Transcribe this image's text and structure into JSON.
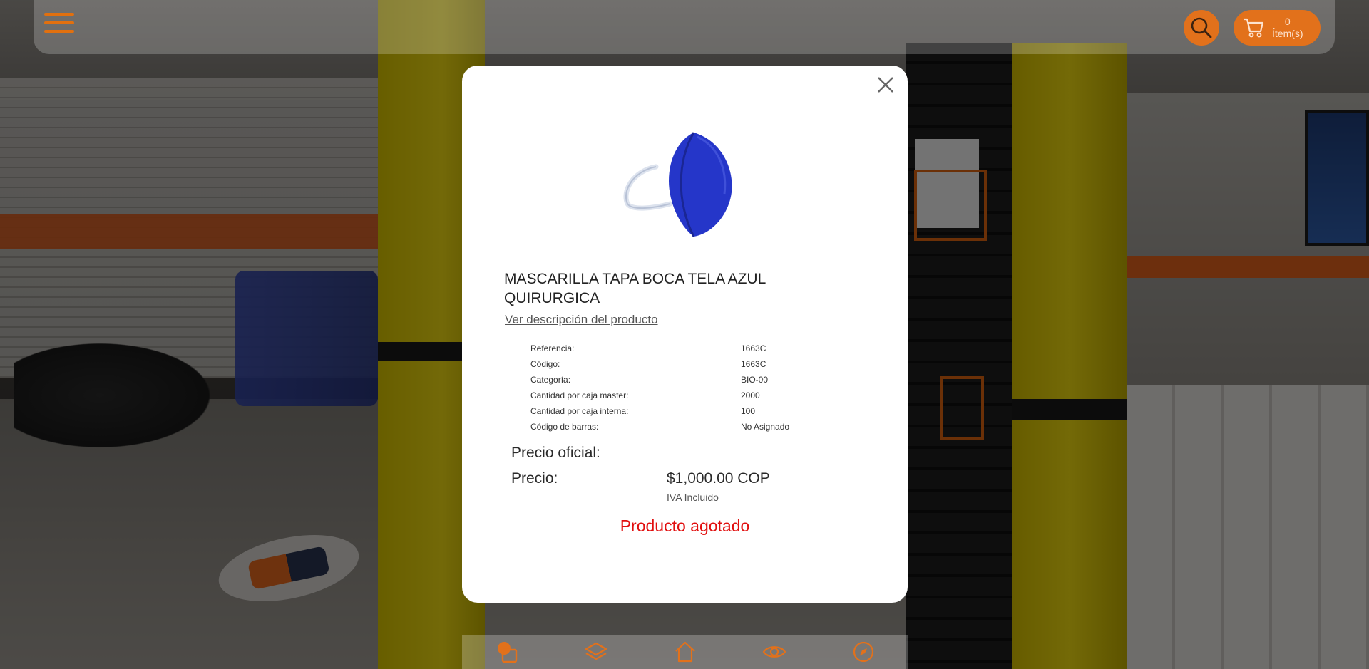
{
  "header": {
    "menu_icon": "hamburger-icon",
    "search_icon": "search-icon",
    "cart": {
      "icon": "cart-icon",
      "count": "0",
      "label": "Ítem(s)"
    }
  },
  "modal": {
    "close_icon": "close-icon",
    "product": {
      "image_alt": "blue surgical face mask",
      "title": "MASCARILLA TAPA BOCA TELA AZUL QUIRURGICA",
      "description_link": "Ver descripción del producto",
      "specs": [
        {
          "label": "Referencia:",
          "value": "1663C"
        },
        {
          "label": "Código:",
          "value": "1663C"
        },
        {
          "label": "Categoría:",
          "value": "BIO-00"
        },
        {
          "label": "Cantidad por caja master:",
          "value": "2000"
        },
        {
          "label": "Cantidad por caja interna:",
          "value": "100"
        },
        {
          "label": "Código de barras:",
          "value": "No Asignado"
        }
      ],
      "official_price_label": "Precio oficial:",
      "price_label": "Precio:",
      "price_value": "$1,000.00 COP",
      "tax_note": "IVA Incluido",
      "stock_status": "Producto agotado"
    }
  },
  "bottom_nav": [
    {
      "icon": "products-icon"
    },
    {
      "icon": "layers-icon"
    },
    {
      "icon": "home-icon"
    },
    {
      "icon": "eye-icon"
    },
    {
      "icon": "compass-icon"
    }
  ],
  "colors": {
    "accent": "#e2711b",
    "out_of_stock": "#e10f0f",
    "modal_bg": "#ffffff"
  }
}
